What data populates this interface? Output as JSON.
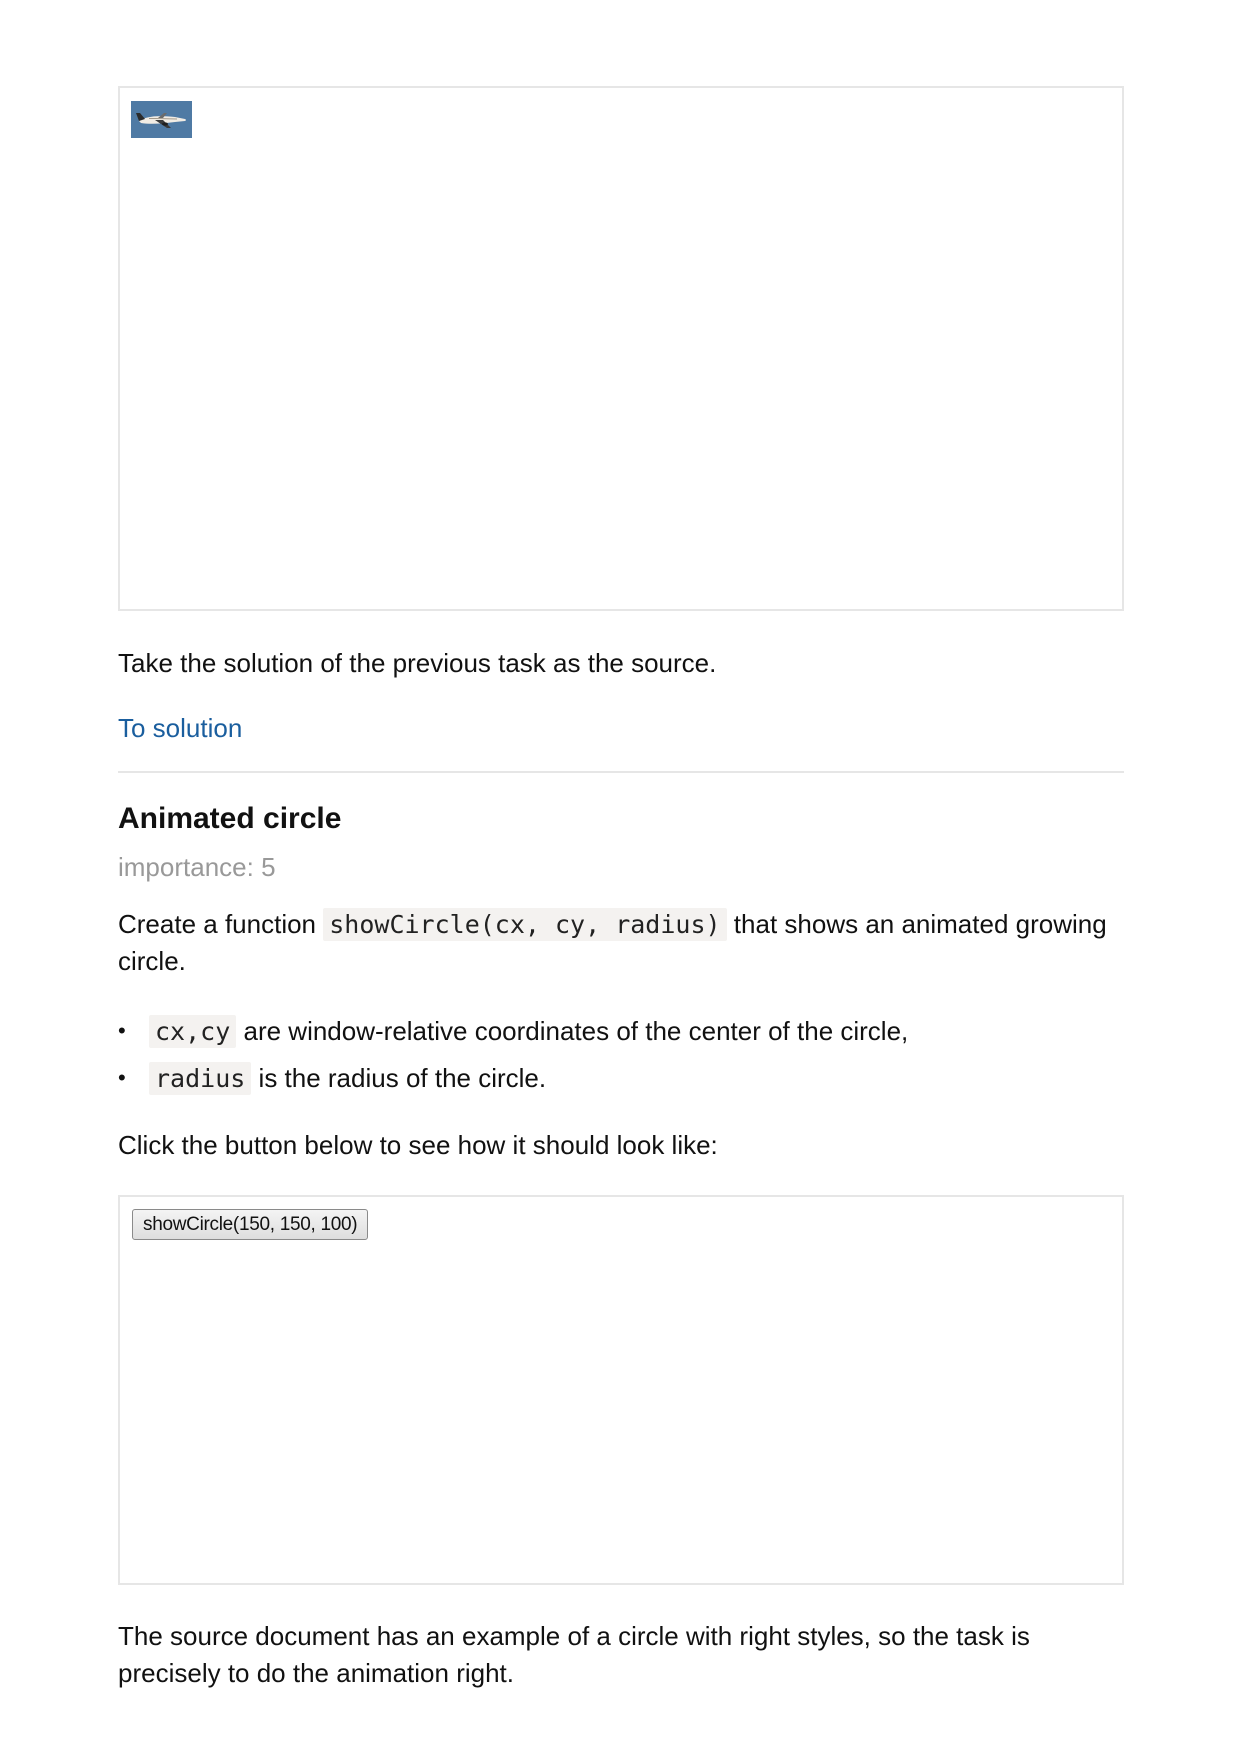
{
  "previous_task": {
    "image_alt": "plane",
    "instruction": "Take the solution of the previous task as the source.",
    "solution_link": "To solution"
  },
  "task": {
    "title": "Animated circle",
    "importance": "importance: 5",
    "intro_before": "Create a function ",
    "intro_code": "showCircle(cx, cy, radius)",
    "intro_after": " that shows an animated growing circle.",
    "bullets": [
      {
        "code": "cx,cy",
        "text": " are window-relative coordinates of the center of the circle,"
      },
      {
        "code": "radius",
        "text": " is the radius of the circle."
      }
    ],
    "click_hint": "Click the button below to see how it should look like:",
    "demo_button_label": "showCircle(150, 150, 100)",
    "footer_text": "The source document has an example of a circle with right styles, so the task is precisely to do the animation right."
  },
  "colors": {
    "link": "#1a5e9e",
    "muted": "#999999",
    "border": "#e6e6e6",
    "code_bg": "#f4f2f0",
    "sky": "#4f7aa4"
  },
  "icons": {
    "bullet": "•"
  }
}
